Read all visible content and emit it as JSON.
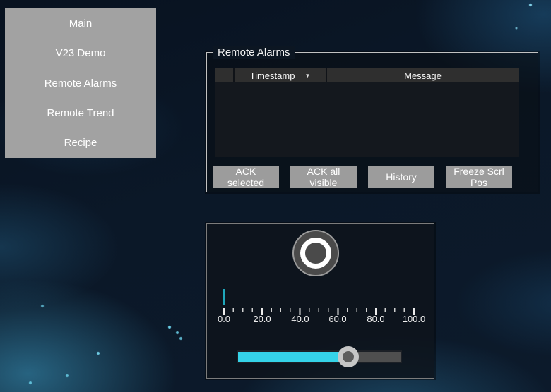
{
  "sidebar": {
    "items": [
      "Main",
      "V23 Demo",
      "Remote Alarms",
      "Remote Trend",
      "Recipe"
    ]
  },
  "alarms": {
    "title": "Remote Alarms",
    "table": {
      "columns": [
        {
          "label": ""
        },
        {
          "label": "Timestamp",
          "sortable": true
        },
        {
          "label": "Message"
        }
      ],
      "sort_icon": "▼",
      "rows": []
    },
    "buttons": [
      "ACK selected",
      "ACK all visible",
      "History",
      "Freeze Scrl Pos"
    ]
  },
  "control_panel": {
    "push_button": {
      "state": "off"
    },
    "gauge": {
      "min": 0.0,
      "max": 100.0,
      "value_percent": 0,
      "tick_labels": [
        "0.0",
        "20.0",
        "40.0",
        "60.0",
        "80.0",
        "100.0"
      ]
    },
    "slider": {
      "min": 0,
      "max": 100,
      "value": 68,
      "fill_percent": 63,
      "knob_percent": 68
    }
  },
  "colors": {
    "accent_cyan": "#35d3e8",
    "pointer_teal": "#1fa7bb",
    "sidebar_gray": "#a2a2a2",
    "button_gray": "#9c9c9c",
    "table_header_gray": "#2f2f2f",
    "background_navy": "#0b1828"
  }
}
